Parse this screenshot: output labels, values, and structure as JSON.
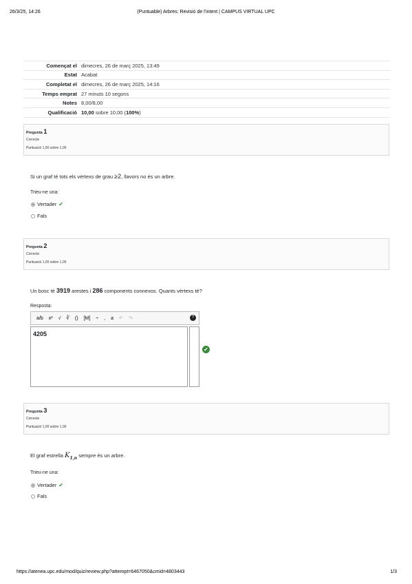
{
  "print_header": {
    "datetime": "26/3/25, 14:26",
    "title": "(Puntuable) Arbres: Revisió de l'intent | CAMPUS VIRTUAL UPC"
  },
  "summary": [
    {
      "label": "Començat el",
      "value": "dimecres, 26 de març 2025, 13:49"
    },
    {
      "label": "Estat",
      "value": "Acabat"
    },
    {
      "label": "Completat el",
      "value": "dimecres, 26 de març 2025, 14:16"
    },
    {
      "label": "Temps emprat",
      "value": "27 minuts 10 segons"
    },
    {
      "label": "Notes",
      "value": "8,00/8,00"
    }
  ],
  "qualification": {
    "label": "Qualificació",
    "score": "10,00",
    "mid": " sobre 10,00 (",
    "percent": "100%",
    "end": ")"
  },
  "questions": [
    {
      "label": "Pregunta",
      "number": "1",
      "state": "Correcte",
      "grade": "Puntuació 1,00 sobre 1,00",
      "text_before": "Si un graf té tots els vèrtexs de grau ",
      "math": "≥2",
      "text_after": ", llavors no és un arbre.",
      "prompt": "Trieu-ne una:",
      "options": [
        {
          "label": "Vertader",
          "checked": true,
          "tick": "✔"
        },
        {
          "label": "Fals",
          "checked": false
        }
      ]
    },
    {
      "label": "Pregunta",
      "number": "2",
      "state": "Correcte",
      "grade": "Puntuació 1,00 sobre 1,00",
      "text_a": "Un bosc té ",
      "num1": "3919",
      "text_b": " arestes i ",
      "num2": "286",
      "text_c": " components connexos. Quants vèrtexs té?",
      "answer_label": "Resposta:",
      "answer_value": "4205",
      "toolbar": [
        "a/b",
        "x²",
        "√",
        "∛",
        "()",
        "[M]",
        "÷",
        ",",
        "a",
        "↶",
        "↷"
      ],
      "help": "?",
      "correct_icon": "✔"
    },
    {
      "label": "Pregunta",
      "number": "3",
      "state": "Correcte",
      "grade": "Puntuació 1,00 sobre 1,00",
      "text_before": "El graf estrella ",
      "math": "K",
      "math_sub": "1,n",
      "text_after": " sempre és un arbre.",
      "prompt": "Trieu-ne una:",
      "options": [
        {
          "label": "Vertader",
          "checked": true,
          "tick": "✔"
        },
        {
          "label": "Fals",
          "checked": false
        }
      ]
    }
  ],
  "print_footer": {
    "url": "https://atenea.upc.edu/mod/quiz/review.php?attempt=6467050&cmid=4803443",
    "page": "1/3"
  }
}
